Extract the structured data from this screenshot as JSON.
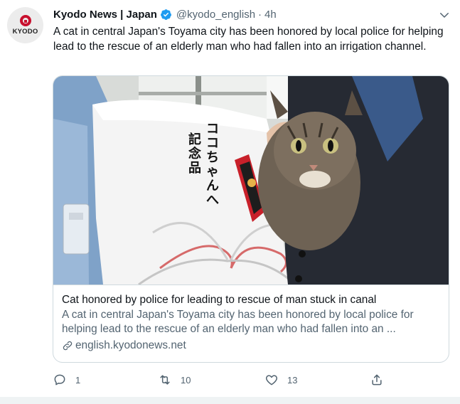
{
  "tweet": {
    "author_name": "Kyodo News | Japan",
    "handle": "@kyodo_english",
    "separator": "·",
    "time": "4h",
    "avatar_text": "KYODO",
    "text": "A cat in central Japan's Toyama city has been honored by local police for helping lead to the rescue of an elderly man who had fallen into an irrigation channel."
  },
  "card": {
    "title": "Cat honored by police for leading to rescue of man stuck in canal",
    "description": "A cat in central Japan's Toyama city has been honored by local police for helping lead to the rescue of an elderly man who had fallen into an ...",
    "domain": "english.kyodonews.net",
    "image_text": "ココちゃんへ 記念品"
  },
  "actions": {
    "replies": "1",
    "retweets": "10",
    "likes": "13"
  },
  "icons": [
    "verified-badge-icon",
    "chevron-down-icon",
    "link-icon",
    "reply-icon",
    "retweet-icon",
    "like-icon",
    "share-icon"
  ],
  "colors": {
    "accent": "#1d9bf0",
    "secondary_text": "#536471",
    "border": "#cfd9de",
    "brand_red": "#c8102e"
  }
}
